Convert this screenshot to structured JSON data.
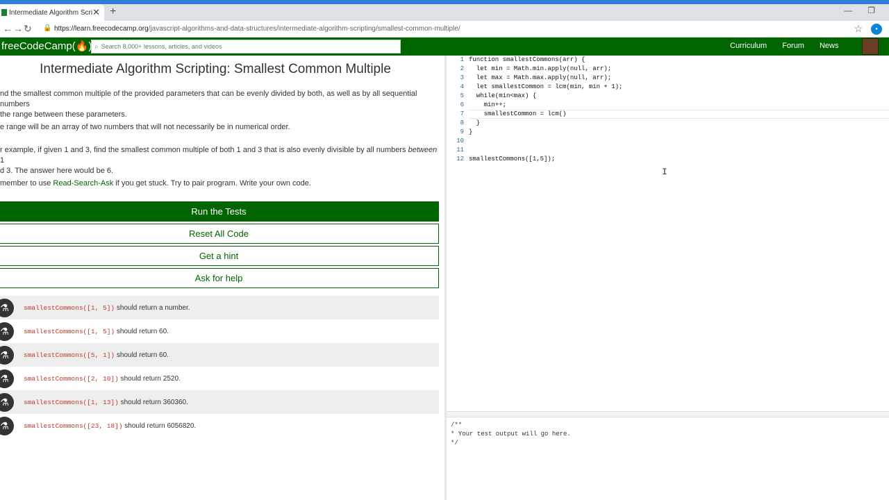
{
  "browser": {
    "tab_title": "Intermediate Algorithm Scripting",
    "url_host": "https://learn.freecodecamp.org",
    "url_path": "/javascript-algorithms-and-data-structures/intermediate-algorithm-scripting/smallest-common-multiple/"
  },
  "nav": {
    "logo": "freeCodeCamp(🔥)",
    "search_placeholder": "Search 8,000+ lessons, articles, and videos",
    "links": [
      "Curriculum",
      "Forum",
      "News"
    ]
  },
  "challenge": {
    "title": "Intermediate Algorithm Scripting: Smallest Common Multiple",
    "p1_line1": "nd the smallest common multiple of the provided parameters that can be evenly divided by both, as well as by all sequential numbers",
    "p1_line2": "the range between these parameters.",
    "p2": "e range will be an array of two numbers that will not necessarily be in numerical order.",
    "p3_line1_a": "r example, if given 1 and 3, find the smallest common multiple of both 1 and 3 that is also evenly divisible by all numbers ",
    "p3_line1_em": "between",
    "p3_line1_b": " 1",
    "p3_line2": "d 3. The answer here would be 6.",
    "p4_a": "member to use ",
    "p4_link": "Read-Search-Ask",
    "p4_b": " if you get stuck. Try to pair program. Write your own code."
  },
  "buttons": {
    "run": "Run the Tests",
    "reset": "Reset All Code",
    "hint": "Get a hint",
    "help": "Ask for help"
  },
  "tests": [
    {
      "code": "smallestCommons([1, 5])",
      "text": " should return a number."
    },
    {
      "code": "smallestCommons([1, 5])",
      "text": " should return 60."
    },
    {
      "code": "smallestCommons([5, 1])",
      "text": " should return 60."
    },
    {
      "code": "smallestCommons([2, 10])",
      "text": " should return 2520."
    },
    {
      "code": "smallestCommons([1, 13])",
      "text": " should return 360360."
    },
    {
      "code": "smallestCommons([23, 18])",
      "text": " should return 6056820."
    }
  ],
  "editor": {
    "lines": [
      {
        "n": "1",
        "text": "function smallestCommons(arr) {"
      },
      {
        "n": "2",
        "text": "  let min = Math.min.apply(null, arr);"
      },
      {
        "n": "3",
        "text": "  let max = Math.max.apply(null, arr);"
      },
      {
        "n": "4",
        "text": "  let smallestCommon = lcm(min, min + 1);"
      },
      {
        "n": "5",
        "text": "  while(min<max) {"
      },
      {
        "n": "6",
        "text": "    min++;"
      },
      {
        "n": "7",
        "text": "    smallestCommon = lcm()"
      },
      {
        "n": "8",
        "text": "  }"
      },
      {
        "n": "9",
        "text": "}"
      },
      {
        "n": "10",
        "text": ""
      },
      {
        "n": "11",
        "text": ""
      },
      {
        "n": "12",
        "text": "smallestCommons([1,5]);"
      }
    ]
  },
  "output": {
    "text": "/**\n* Your test output will go here.\n*/"
  }
}
